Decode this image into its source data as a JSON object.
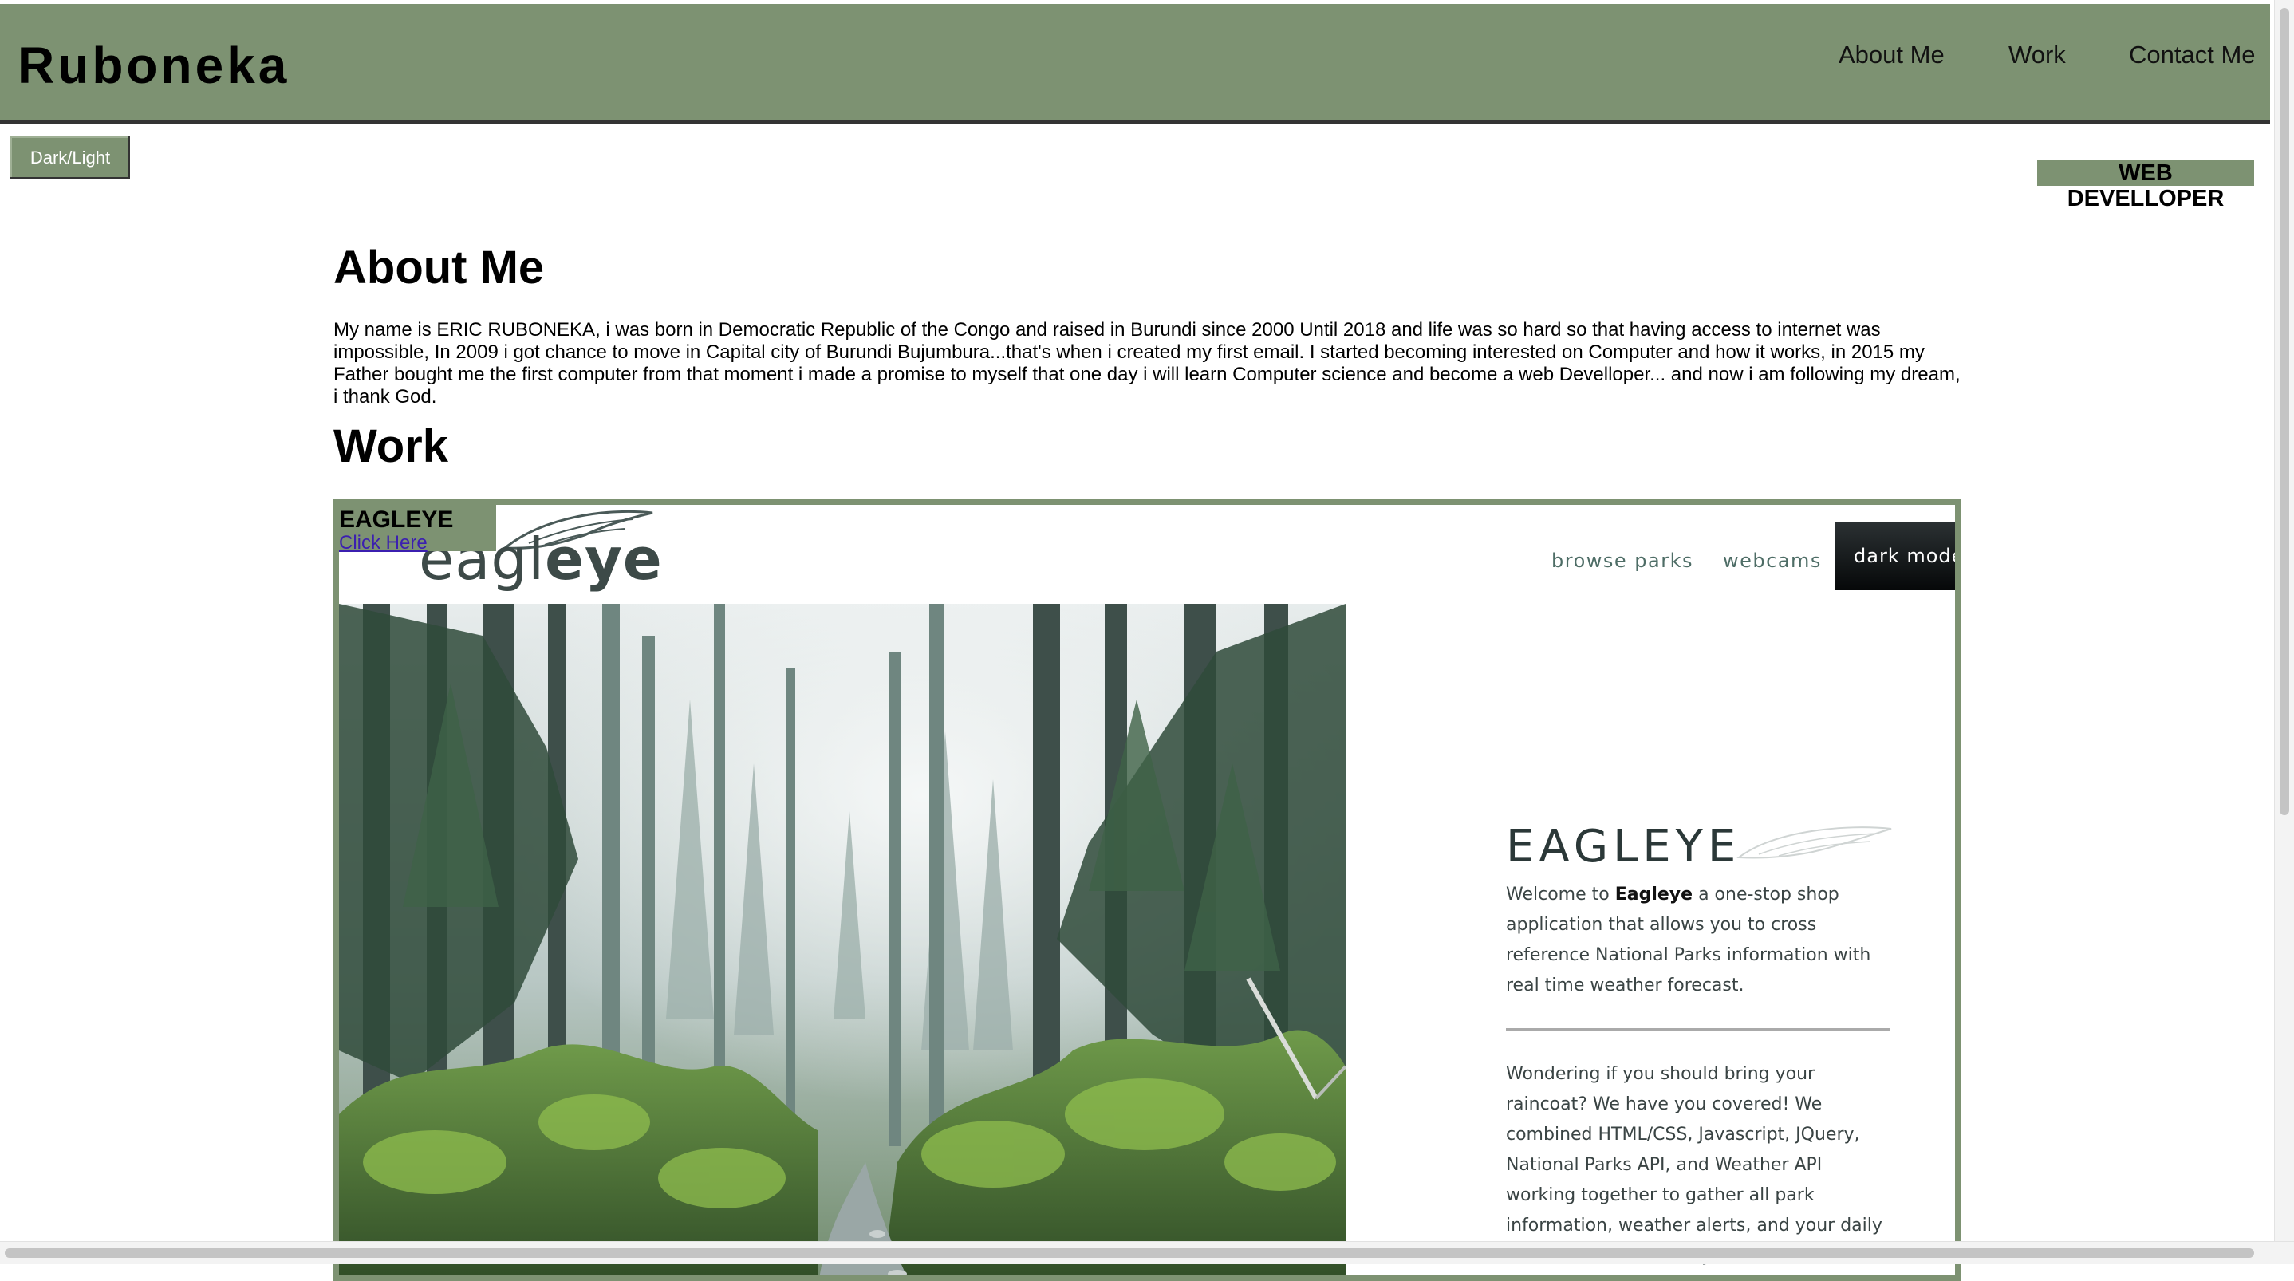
{
  "header": {
    "brand": "Ruboneka",
    "nav": [
      "About Me",
      "Work",
      "Contact Me"
    ]
  },
  "controls": {
    "theme_toggle_label": "Dark/Light",
    "role_badge": "WEB DEVELLOPER"
  },
  "about": {
    "heading": "About Me",
    "text": "My name is ERIC RUBONEKA, i was born in Democratic Republic of the Congo and raised in Burundi since 2000 Until 2018 and life was so hard so that having access to internet was impossible, In 2009 i got chance to move in Capital city of Burundi Bujumbura...that's when i created my first email. I started becoming interested on Computer and how it works, in 2015 my Father bought me the first computer from that moment i made a promise to myself that one day i will learn Computer science and become a web Develloper... and now i am following my dream, i thank God."
  },
  "work": {
    "heading": "Work",
    "project": {
      "name": "EAGLEYE",
      "link_label": "Click Here",
      "preview": {
        "logo_light": "eag",
        "logo_mid": "l",
        "logo_bold": "eye",
        "nav": [
          "browse parks",
          "webcams"
        ],
        "dark_mode_label": "dark mode",
        "title": "EAGLEYE",
        "intro_before": "Welcome to ",
        "intro_bold": "Eagleye",
        "intro_after": " a one-stop shop application that allows you to cross reference National Parks information with real time weather forecast.",
        "details": "Wondering if you should bring your raincoat? We have you covered! We combined HTML/CSS, Javascript, JQuery, National Parks API, and Weather API working together to gather all park information, weather alerts, and your daily weather forecast - for your"
      }
    }
  },
  "colors": {
    "accent": "#7d9272",
    "header_border": "#333333",
    "link": "#3b1fb0"
  }
}
